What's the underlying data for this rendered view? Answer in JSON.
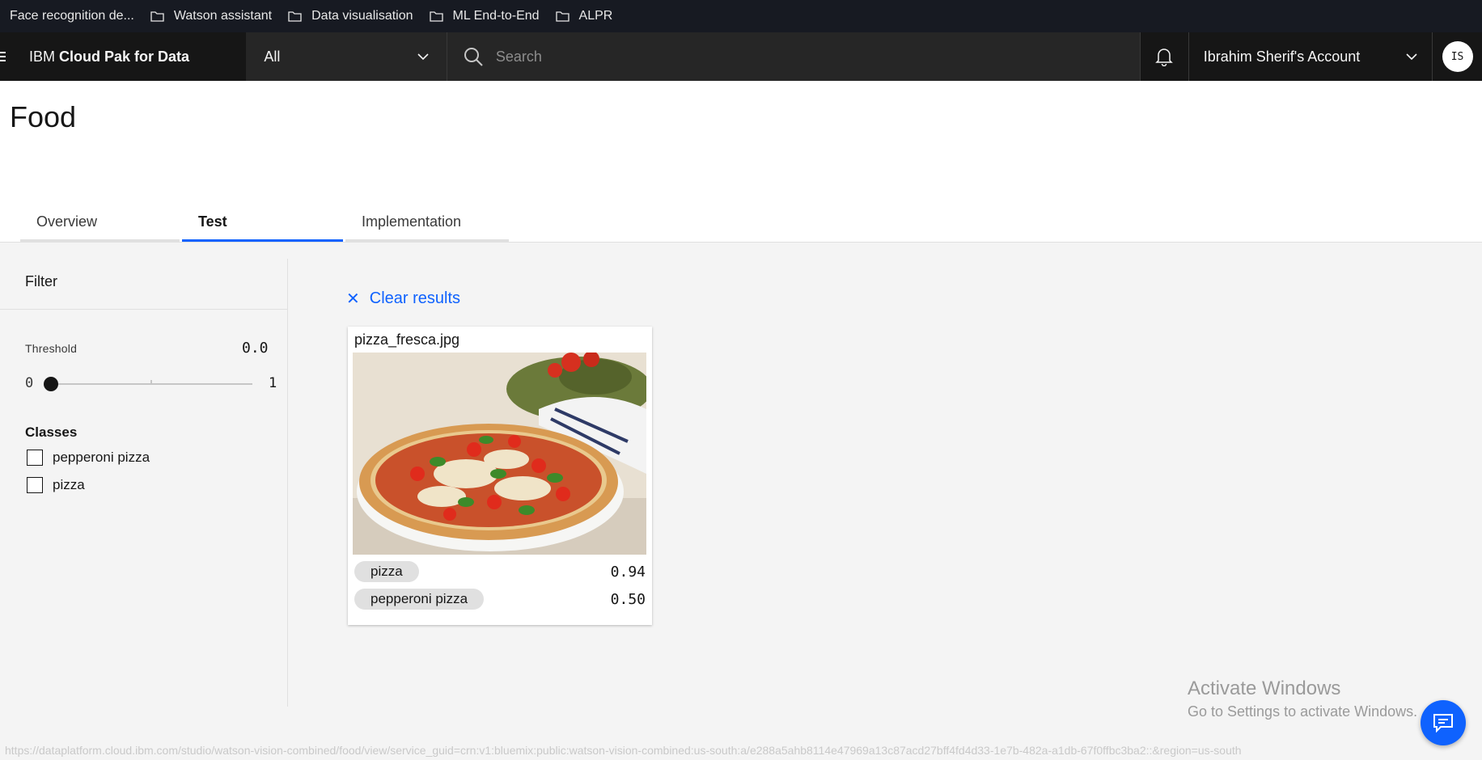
{
  "bookmarks": [
    {
      "label": "Face recognition de..."
    },
    {
      "label": "Watson assistant"
    },
    {
      "label": "Data visualisation"
    },
    {
      "label": "ML End-to-End"
    },
    {
      "label": "ALPR"
    }
  ],
  "header": {
    "brand_prefix": "IBM",
    "brand_name": "Cloud Pak for Data",
    "scope_value": "All",
    "search_placeholder": "Search",
    "account_name": "Ibrahim Sherif's Account",
    "avatar_initials": "IS"
  },
  "page": {
    "title": "Food",
    "tabs": [
      {
        "label": "Overview",
        "active": false
      },
      {
        "label": "Test",
        "active": true
      },
      {
        "label": "Implementation",
        "active": false
      }
    ]
  },
  "filter": {
    "title": "Filter",
    "threshold_label": "Threshold",
    "threshold_value": "0.0",
    "slider_min": "0",
    "slider_max": "1",
    "slider_level": 0.0,
    "classes_title": "Classes",
    "classes": [
      {
        "label": "pepperoni pizza",
        "checked": false
      },
      {
        "label": "pizza",
        "checked": false
      }
    ]
  },
  "results": {
    "clear_label": "Clear results",
    "card": {
      "filename": "pizza_fresca.jpg",
      "tags": [
        {
          "label": "pizza",
          "score": "0.94"
        },
        {
          "label": "pepperoni pizza",
          "score": "0.50"
        }
      ]
    }
  },
  "watermark": {
    "line1": "Activate Windows",
    "line2": "Go to Settings to activate Windows."
  },
  "status_url": "https://dataplatform.cloud.ibm.com/studio/watson-vision-combined/food/view/service_guid=crn:v1:bluemix:public:watson-vision-combined:us-south:a/e288a5ahb8114e47969a13c87acd27bff4fd4d33-1e7b-482a-a1db-67f0ffbc3ba2::&region=us-south",
  "colors": {
    "accent": "#0f62fe",
    "header_bg": "#161616",
    "bookmark_bg": "#171a22",
    "page_bg": "#f4f4f4"
  }
}
